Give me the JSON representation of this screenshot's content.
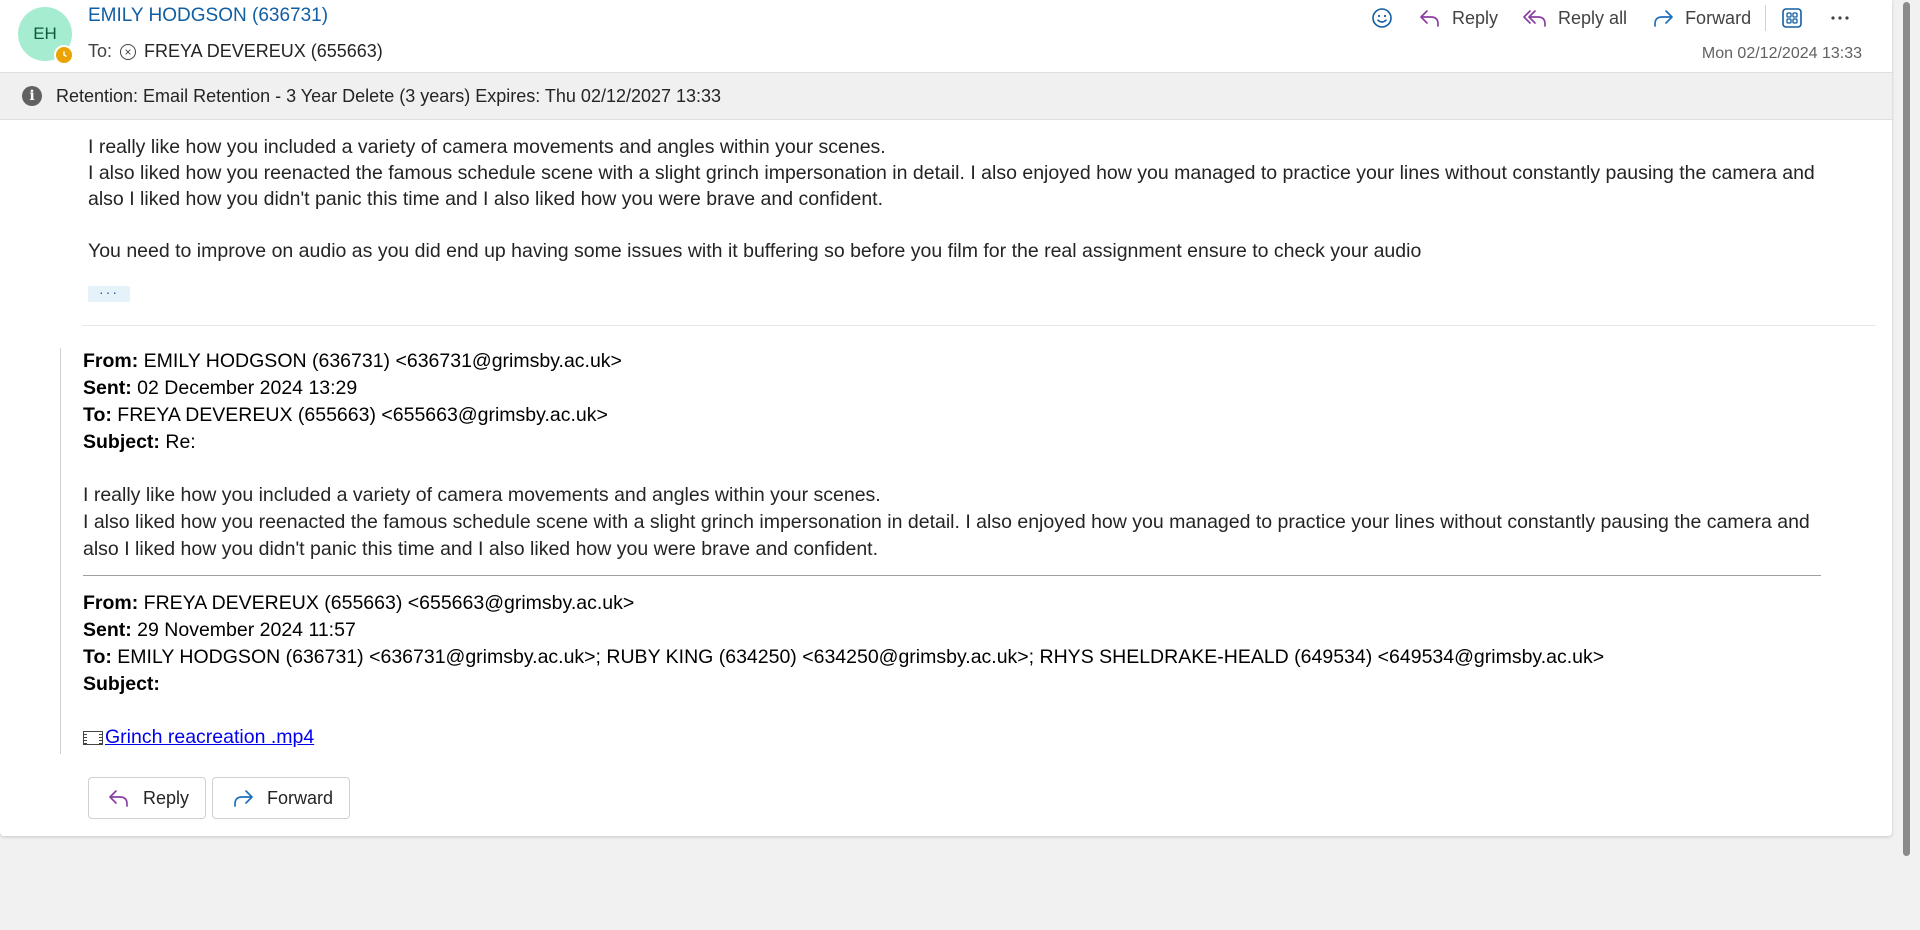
{
  "message": {
    "sender": {
      "initials": "EH",
      "name": "EMILY HODGSON (636731)",
      "avatar_color": "#a6ecd0",
      "presence": "away"
    },
    "to_label": "To:",
    "recipient": "FREYA DEVEREUX (655663)",
    "date": "Mon 02/12/2024 13:33"
  },
  "actions": {
    "emoji_icon": "smiley-icon",
    "reply": "Reply",
    "reply_all": "Reply all",
    "forward": "Forward",
    "apps_icon": "apps-icon",
    "more_icon": "more-icon"
  },
  "retention": {
    "text": "Retention: Email Retention - 3 Year Delete (3 years) Expires: Thu 02/12/2027 13:33"
  },
  "body": {
    "line1": "I really like how you included a variety of camera movements and angles within your scenes.",
    "line2": "I also  liked how you reenacted the famous schedule scene with a slight grinch impersonation in detail. I also enjoyed how you managed to practice your lines without constantly pausing the camera and also I liked how you didn't panic this time and I also liked how you were brave and confident.",
    "line3": "You need to improve on audio as you did end up having some issues with it buffering so before you film for the real assignment ensure to check your audio",
    "show_more": "···"
  },
  "quoted1": {
    "from_label": "From:",
    "from": "EMILY HODGSON (636731) <636731@grimsby.ac.uk>",
    "sent_label": "Sent:",
    "sent": "02 December 2024 13:29",
    "to_label": "To:",
    "to": "FREYA DEVEREUX (655663) <655663@grimsby.ac.uk>",
    "subject_label": "Subject:",
    "subject": "Re:",
    "line1": "I really like how you included a variety of camera movements and angles within your scenes.",
    "line2": "I also  liked how you reenacted the famous schedule scene with a slight grinch impersonation in detail. I also enjoyed how you managed to practice your lines without constantly pausing the camera and also I liked how you didn't panic this time and I also liked how you were brave and confident."
  },
  "quoted2": {
    "from_label": "From:",
    "from": "FREYA DEVEREUX (655663) <655663@grimsby.ac.uk>",
    "sent_label": "Sent:",
    "sent": "29 November 2024 11:57",
    "to_label": "To:",
    "to": "EMILY HODGSON (636731) <636731@grimsby.ac.uk>; RUBY KING (634250) <634250@grimsby.ac.uk>; RHYS SHELDRAKE-HEALD (649534) <649534@grimsby.ac.uk>",
    "subject_label": "Subject:",
    "subject": "",
    "attachment": "Grinch reacreation .mp4"
  },
  "footer": {
    "reply": "Reply",
    "forward": "Forward"
  },
  "colors": {
    "accent": "#115ea3",
    "reply_icon": "#8a3fa0",
    "forward_icon": "#1f6fbf"
  }
}
